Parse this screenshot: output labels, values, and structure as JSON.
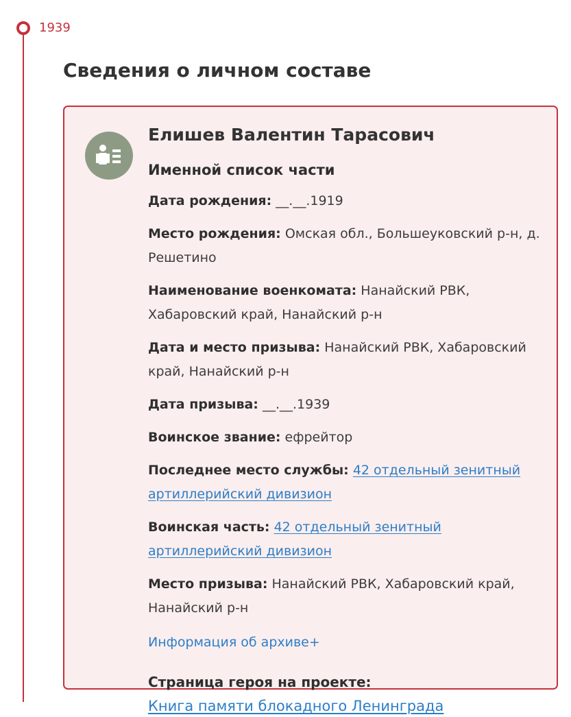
{
  "timeline": {
    "year": "1939"
  },
  "section": {
    "title": "Сведения о личном составе"
  },
  "card": {
    "person_name": "Елишев Валентин Тарасович",
    "record_title": "Именной список части",
    "fields": {
      "birth_date": {
        "label": "Дата рождения:",
        "value": "__.__.1919"
      },
      "birth_place": {
        "label": "Место рождения:",
        "value": "Омская обл., Большеуковский р-н, д. Решетино"
      },
      "commissariat": {
        "label": "Наименование военкомата:",
        "value": "Нанайский РВК, Хабаровский край, Нанайский р-н"
      },
      "draft_date_place": {
        "label": "Дата и место призыва:",
        "value": "Нанайский РВК, Хабаровский край, Нанайский р-н"
      },
      "draft_date": {
        "label": "Дата призыва:",
        "value": "__.__.1939"
      },
      "rank": {
        "label": "Воинское звание:",
        "value": "ефрейтор"
      },
      "last_service_place": {
        "label": "Последнее место службы:",
        "value": "42 отдельный зенитный артиллерийский дивизион"
      },
      "military_unit": {
        "label": "Воинская часть:",
        "value": "42 отдельный зенитный артиллерийский дивизион"
      },
      "draft_place": {
        "label": "Место призыва:",
        "value": "Нанайский РВК, Хабаровский край, Нанайский р-н"
      }
    },
    "archive_link": "Информация об архиве+",
    "hero_page_label": "Страница героя на проекте:",
    "hero_page_link": "Книга памяти блокадного Ленинграда"
  },
  "icons": {
    "avatar": "person-list-icon",
    "timeline_marker": "timeline-dot-icon"
  },
  "colors": {
    "accent": "#c4323c",
    "card_background": "#fbeeee",
    "link": "#2d7ec7",
    "avatar_background": "#8d9b84"
  }
}
